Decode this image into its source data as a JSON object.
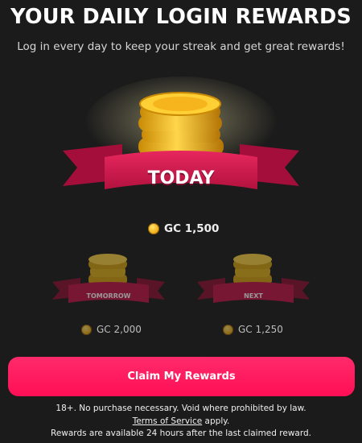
{
  "header": {
    "title": "YOUR DAILY LOGIN REWARDS",
    "subtitle": "Log in every day to keep your streak and get great rewards!"
  },
  "rewards": {
    "today": {
      "ribbon_label": "TODAY",
      "amount": "GC 1,500"
    },
    "tomorrow": {
      "ribbon_label": "TOMORROW",
      "amount": "GC 2,000"
    },
    "next": {
      "ribbon_label": "NEXT",
      "amount": "GC 1,250"
    }
  },
  "claim_button": {
    "label": "Claim My Rewards"
  },
  "footer": {
    "disclaimer": "18+. No purchase necessary. Void where prohibited by law.",
    "terms_link": "Terms of Service",
    "terms_suffix": " apply.",
    "rewards_note": "Rewards are available 24 hours after the last claimed reward."
  },
  "colors": {
    "background": "#1b1b1b",
    "ribbon": "#d9184f",
    "button": "#ff1a5c",
    "coin_gold": "#f2b01c"
  },
  "icons": {
    "coin_stack": "coin-stack-icon",
    "coin": "gold-coin-icon"
  }
}
